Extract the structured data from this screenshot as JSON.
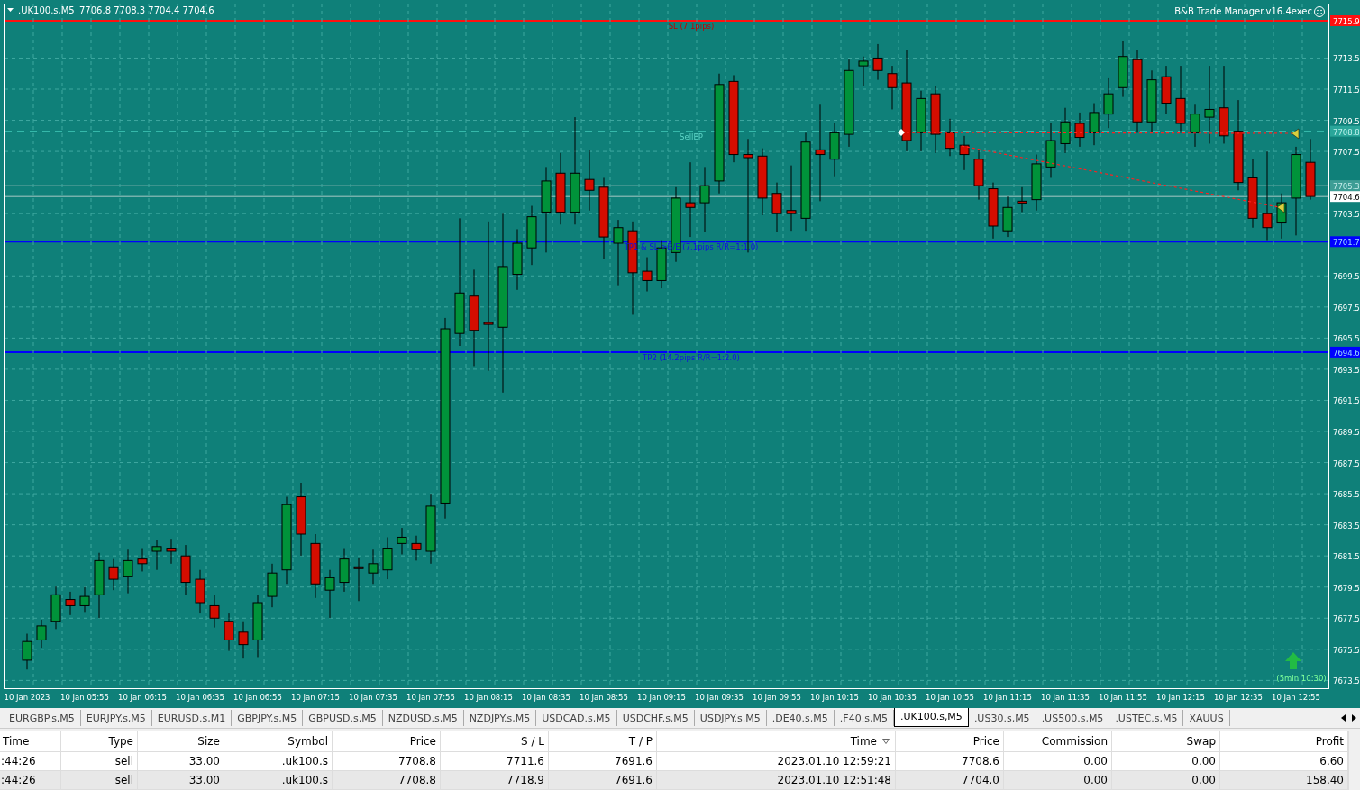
{
  "chart": {
    "symbol": ".UK100.s,M5",
    "ohlc": "7706.8 7708.3 7704.4 7704.6",
    "indicator": "B&B Trade Manager.v16.4exec",
    "chart_data": {
      "type": "candlestick",
      "categories": [
        "10 Jan 2023",
        null,
        null,
        null,
        "10 Jan 05:55",
        null,
        null,
        null,
        "10 Jan 06:15",
        null,
        null,
        null,
        "10 Jan 06:35",
        null,
        null,
        null,
        "10 Jan 06:55",
        null,
        null,
        null,
        "10 Jan 07:15",
        null,
        null,
        null,
        "10 Jan 07:35",
        null,
        null,
        null,
        "10 Jan 07:55",
        null,
        null,
        null,
        "10 Jan 08:15",
        null,
        null,
        null,
        "10 Jan 08:35",
        null,
        null,
        null,
        "10 Jan 08:55",
        null,
        null,
        null,
        "10 Jan 09:15",
        null,
        null,
        null,
        "10 Jan 09:35",
        null,
        null,
        null,
        "10 Jan 09:55",
        null,
        null,
        null,
        "10 Jan 10:15",
        null,
        null,
        null,
        "10 Jan 10:35",
        null,
        null,
        null,
        "10 Jan 10:55",
        null,
        null,
        null,
        "10 Jan 11:15",
        null,
        null,
        null,
        "10 Jan 11:35",
        null,
        null,
        null,
        "10 Jan 11:55",
        null,
        null,
        null,
        "10 Jan 12:15",
        null,
        null,
        null,
        "10 Jan 12:35",
        null,
        null,
        null,
        "10 Jan 12:55",
        null
      ],
      "ylim": [
        7673.0,
        7717.0
      ],
      "ohlc": [
        [
          7674.8,
          7676.5,
          7674.2,
          7676.0
        ],
        [
          7676.1,
          7677.4,
          7675.6,
          7677.0
        ],
        [
          7677.3,
          7679.6,
          7676.8,
          7679.0
        ],
        [
          7678.7,
          7679.2,
          7677.7,
          7678.3
        ],
        [
          7678.3,
          7679.5,
          7677.9,
          7678.9
        ],
        [
          7679.0,
          7681.7,
          7677.5,
          7681.2
        ],
        [
          7680.8,
          7681.3,
          7679.3,
          7680.0
        ],
        [
          7680.2,
          7681.9,
          7679.1,
          7681.2
        ],
        [
          7681.3,
          7682.0,
          7680.5,
          7681.0
        ],
        [
          7681.8,
          7682.5,
          7680.6,
          7682.1
        ],
        [
          7682.0,
          7682.6,
          7681.0,
          7681.8
        ],
        [
          7681.5,
          7682.2,
          7679.0,
          7679.8
        ],
        [
          7680.0,
          7680.6,
          7677.8,
          7678.5
        ],
        [
          7678.3,
          7679.0,
          7676.9,
          7677.5
        ],
        [
          7677.3,
          7677.8,
          7675.4,
          7676.1
        ],
        [
          7676.6,
          7677.3,
          7674.9,
          7675.8
        ],
        [
          7676.1,
          7679.0,
          7675.0,
          7678.5
        ],
        [
          7678.9,
          7681.0,
          7678.2,
          7680.4
        ],
        [
          7680.6,
          7685.3,
          7679.7,
          7684.8
        ],
        [
          7685.3,
          7686.2,
          7681.5,
          7682.9
        ],
        [
          7682.3,
          7682.9,
          7678.8,
          7679.7
        ],
        [
          7679.3,
          7680.6,
          7677.5,
          7680.1
        ],
        [
          7679.8,
          7682.0,
          7679.2,
          7681.3
        ],
        [
          7680.8,
          7681.4,
          7678.6,
          7680.7
        ],
        [
          7680.4,
          7681.9,
          7679.7,
          7681.0
        ],
        [
          7680.6,
          7682.7,
          7680.0,
          7682.0
        ],
        [
          7682.3,
          7683.3,
          7681.6,
          7682.7
        ],
        [
          7682.3,
          7682.8,
          7681.2,
          7681.9
        ],
        [
          7681.8,
          7685.5,
          7681.0,
          7684.7
        ],
        [
          7684.9,
          7696.8,
          7683.9,
          7696.1
        ],
        [
          7695.8,
          7703.2,
          7695.0,
          7698.4
        ],
        [
          7698.2,
          7699.9,
          7693.7,
          7696.0
        ],
        [
          7696.5,
          7703.0,
          7693.4,
          7696.4
        ],
        [
          7696.2,
          7703.5,
          7692.0,
          7700.1
        ],
        [
          7699.6,
          7702.5,
          7698.6,
          7701.6
        ],
        [
          7701.3,
          7704.0,
          7700.2,
          7703.3
        ],
        [
          7703.6,
          7706.5,
          7701.0,
          7705.6
        ],
        [
          7706.1,
          7707.4,
          7702.8,
          7703.6
        ],
        [
          7703.6,
          7709.7,
          7702.8,
          7706.1
        ],
        [
          7705.7,
          7707.6,
          7703.7,
          7705.0
        ],
        [
          7705.2,
          7705.8,
          7700.6,
          7702.0
        ],
        [
          7701.6,
          7703.1,
          7698.9,
          7702.6
        ],
        [
          7702.4,
          7703.0,
          7697.0,
          7699.7
        ],
        [
          7699.8,
          7700.7,
          7698.5,
          7699.2
        ],
        [
          7699.2,
          7701.8,
          7698.7,
          7701.3
        ],
        [
          7701.0,
          7705.2,
          7700.4,
          7704.5
        ],
        [
          7704.2,
          7706.8,
          7702.0,
          7703.9
        ],
        [
          7704.2,
          7706.5,
          7702.3,
          7705.3
        ],
        [
          7705.6,
          7712.5,
          7704.8,
          7711.8
        ],
        [
          7712.0,
          7712.4,
          7706.8,
          7707.3
        ],
        [
          7707.3,
          7708.3,
          7701.0,
          7707.1
        ],
        [
          7707.2,
          7707.7,
          7703.4,
          7704.5
        ],
        [
          7704.8,
          7705.5,
          7702.3,
          7703.5
        ],
        [
          7703.7,
          7706.6,
          7702.4,
          7703.5
        ],
        [
          7703.2,
          7708.7,
          7702.4,
          7708.1
        ],
        [
          7707.6,
          7710.5,
          7704.3,
          7707.3
        ],
        [
          7707.0,
          7709.3,
          7705.9,
          7708.7
        ],
        [
          7708.6,
          7713.4,
          7707.8,
          7712.7
        ],
        [
          7713.0,
          7713.6,
          7711.7,
          7713.3
        ],
        [
          7713.5,
          7714.4,
          7712.1,
          7712.7
        ],
        [
          7712.5,
          7713.0,
          7710.2,
          7711.6
        ],
        [
          7711.9,
          7714.0,
          7707.5,
          7708.2
        ],
        [
          7708.7,
          7711.4,
          7707.5,
          7710.9
        ],
        [
          7711.2,
          7711.7,
          7707.4,
          7708.6
        ],
        [
          7708.7,
          7709.6,
          7707.2,
          7707.7
        ],
        [
          7707.9,
          7708.5,
          7706.3,
          7707.3
        ],
        [
          7707.0,
          7707.6,
          7704.4,
          7705.3
        ],
        [
          7705.1,
          7705.5,
          7701.9,
          7702.7
        ],
        [
          7702.4,
          7704.6,
          7702.0,
          7703.9
        ],
        [
          7704.3,
          7705.2,
          7703.6,
          7704.2
        ],
        [
          7704.4,
          7707.3,
          7703.7,
          7706.7
        ],
        [
          7706.5,
          7709.3,
          7705.8,
          7708.2
        ],
        [
          7708.0,
          7710.3,
          7707.4,
          7709.4
        ],
        [
          7709.3,
          7710.0,
          7707.8,
          7708.4
        ],
        [
          7708.7,
          7710.6,
          7707.9,
          7710.0
        ],
        [
          7709.9,
          7712.2,
          7709.0,
          7711.2
        ],
        [
          7711.6,
          7714.6,
          7711.0,
          7713.6
        ],
        [
          7713.4,
          7714.0,
          7708.7,
          7709.4
        ],
        [
          7709.4,
          7712.7,
          7708.7,
          7712.1
        ],
        [
          7712.3,
          7713.0,
          7709.9,
          7710.6
        ],
        [
          7710.9,
          7713.0,
          7708.7,
          7709.3
        ],
        [
          7708.7,
          7710.5,
          7707.8,
          7709.9
        ],
        [
          7709.7,
          7713.0,
          7708.0,
          7710.2
        ],
        [
          7710.3,
          7713.0,
          7708.0,
          7708.5
        ],
        [
          7708.8,
          7710.8,
          7705.0,
          7705.5
        ],
        [
          7705.8,
          7707.0,
          7702.6,
          7703.2
        ],
        [
          7703.5,
          7707.5,
          7701.8,
          7702.6
        ],
        [
          7702.9,
          7704.8,
          7701.9,
          7704.2
        ],
        [
          7704.5,
          7707.8,
          7702.1,
          7707.3
        ],
        [
          7706.8,
          7708.3,
          7704.4,
          7704.6
        ]
      ],
      "yticks": [
        7713.5,
        7711.5,
        7709.5,
        7707.5,
        7703.5,
        7699.5,
        7697.5,
        7695.5,
        7693.5,
        7691.5,
        7689.5,
        7687.5,
        7685.5,
        7683.5,
        7681.5,
        7679.5,
        7677.5,
        7675.5,
        7673.5
      ],
      "grid": true
    },
    "levels": [
      {
        "kind": "sl",
        "label": "SL (7.1pips)",
        "tag": "7715.9"
      },
      {
        "kind": "entry",
        "label": "SellEP",
        "tag": "7708.8"
      },
      {
        "kind": "reference",
        "tag": "7705.3"
      },
      {
        "kind": "bid",
        "tag": "7704.6"
      },
      {
        "kind": "tp",
        "label": "TP1 & SL->B/E (7.1pips R/R=1:1.0)",
        "tag": "7701.7"
      },
      {
        "kind": "tp",
        "label": "TP2 (14.2pips R/R=1:2.0)",
        "tag": "7694.6"
      }
    ],
    "signal": "(5min 10:30)"
  },
  "tabs": [
    {
      "label": "EURGBP.s,M5",
      "selected": false
    },
    {
      "label": "EURJPY.s,M5",
      "selected": false
    },
    {
      "label": "EURUSD.s,M1",
      "selected": false
    },
    {
      "label": "GBPJPY.s,M5",
      "selected": false
    },
    {
      "label": "GBPUSD.s,M5",
      "selected": false
    },
    {
      "label": "NZDUSD.s,M5",
      "selected": false
    },
    {
      "label": "NZDJPY.s,M5",
      "selected": false
    },
    {
      "label": "USDCAD.s,M5",
      "selected": false
    },
    {
      "label": "USDCHF.s,M5",
      "selected": false
    },
    {
      "label": "USDJPY.s,M5",
      "selected": false
    },
    {
      "label": ".DE40.s,M5",
      "selected": false
    },
    {
      "label": ".F40.s,M5",
      "selected": false
    },
    {
      "label": ".UK100.s,M5",
      "selected": true
    },
    {
      "label": ".US30.s,M5",
      "selected": false
    },
    {
      "label": ".US500.s,M5",
      "selected": false
    },
    {
      "label": ".USTEC.s,M5",
      "selected": false
    },
    {
      "label": "XAUUS",
      "selected": false
    }
  ],
  "table": {
    "columns": [
      "Time",
      "Type",
      "Size",
      "Symbol",
      "Price",
      "S / L",
      "T / P",
      "Time",
      "Price",
      "Commission",
      "Swap",
      "Profit"
    ],
    "rows": [
      [
        ":44:26",
        "sell",
        "33.00",
        ".uk100.s",
        "7708.8",
        "7711.6",
        "7691.6",
        "2023.01.10 12:59:21",
        "7708.6",
        "0.00",
        "0.00",
        "6.60"
      ],
      [
        ":44:26",
        "sell",
        "33.00",
        ".uk100.s",
        "7708.8",
        "7718.9",
        "7691.6",
        "2023.01.10 12:51:48",
        "7704.0",
        "0.00",
        "0.00",
        "158.40"
      ]
    ]
  }
}
